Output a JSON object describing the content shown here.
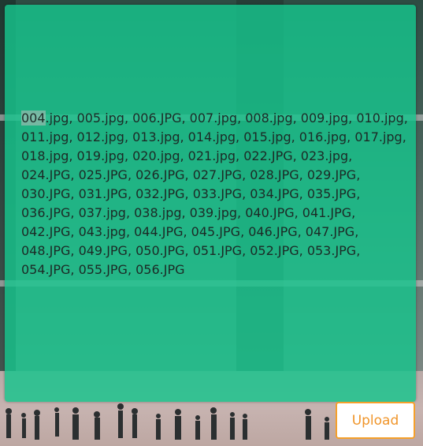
{
  "file_list": {
    "first_item": "004",
    "rest_text": ".jpg, 005.jpg, 006.JPG, 007.jpg, 008.jpg, 009.jpg, 010.jpg, 011.jpg, 012.jpg, 013.jpg, 014.jpg, 015.jpg, 016.jpg, 017.jpg, 018.jpg, 019.jpg, 020.jpg, 021.jpg, 022.JPG, 023.jpg, 024.JPG, 025.JPG, 026.JPG, 027.JPG, 028.JPG, 029.JPG, 030.JPG, 031.JPG, 032.JPG, 033.JPG, 034.JPG, 035.JPG, 036.JPG, 037.jpg, 038.jpg, 039.jpg, 040.JPG, 041.JPG, 042.JPG, 043.jpg, 044.JPG, 045.JPG, 046.JPG, 047.JPG, 048.JPG, 049.JPG, 050.JPG, 051.JPG, 052.JPG, 053.JPG, 054.JPG, 055.JPG, 056.JPG"
  },
  "upload": {
    "label": "Upload"
  },
  "colors": {
    "panel": "#16c48c",
    "upload_border": "#f5a02a",
    "upload_text": "#f0952a"
  }
}
